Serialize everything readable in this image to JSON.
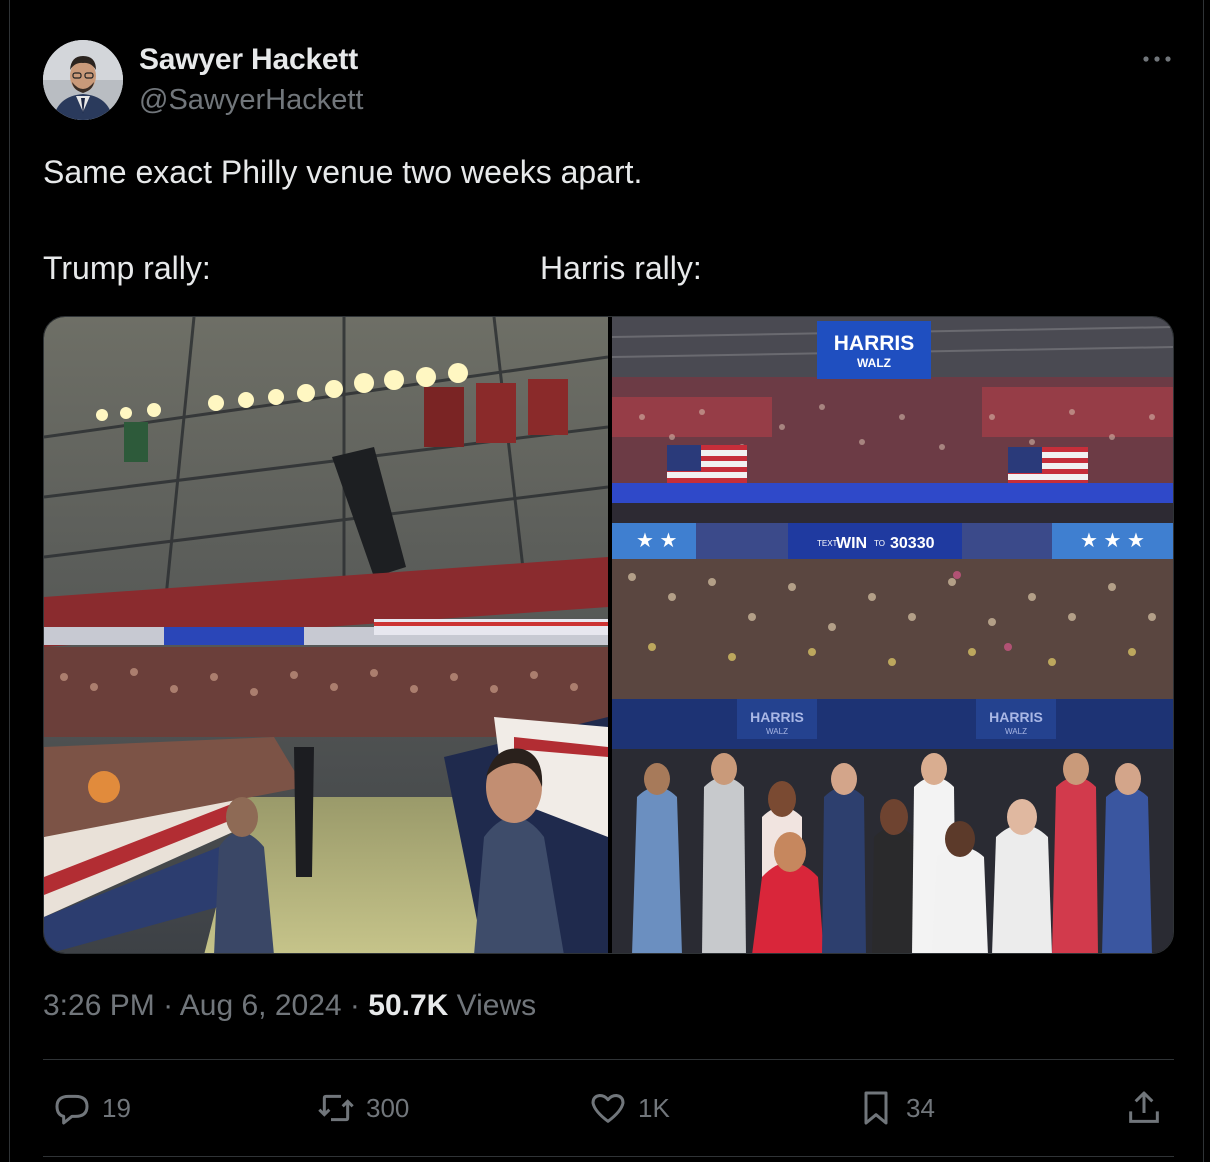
{
  "author": {
    "name": "Sawyer Hackett",
    "handle": "@SawyerHackett"
  },
  "tweet": {
    "text_line1": "Same exact Philly venue two weeks apart.",
    "label_left": "Trump rally:",
    "label_right": "Harris rally:"
  },
  "media": {
    "right_banner_top_line1": "HARRIS",
    "right_banner_top_line2": "WALZ",
    "right_banner_text_left": "TEXT",
    "right_banner_text_win": "WIN",
    "right_banner_text_to": "TO",
    "right_banner_text_number": "30330",
    "right_stage_sign": "HARRIS",
    "right_stage_sign_sub": "WALZ"
  },
  "meta": {
    "time": "3:26 PM",
    "separator": "·",
    "date": "Aug 6, 2024",
    "views_count": "50.7K",
    "views_label": "Views"
  },
  "actions": {
    "replies": "19",
    "reposts": "300",
    "likes": "1K",
    "bookmarks": "34"
  },
  "colors": {
    "background": "#000000",
    "text_primary": "#e7e9ea",
    "text_secondary": "#71767b",
    "border": "#2f3336"
  }
}
